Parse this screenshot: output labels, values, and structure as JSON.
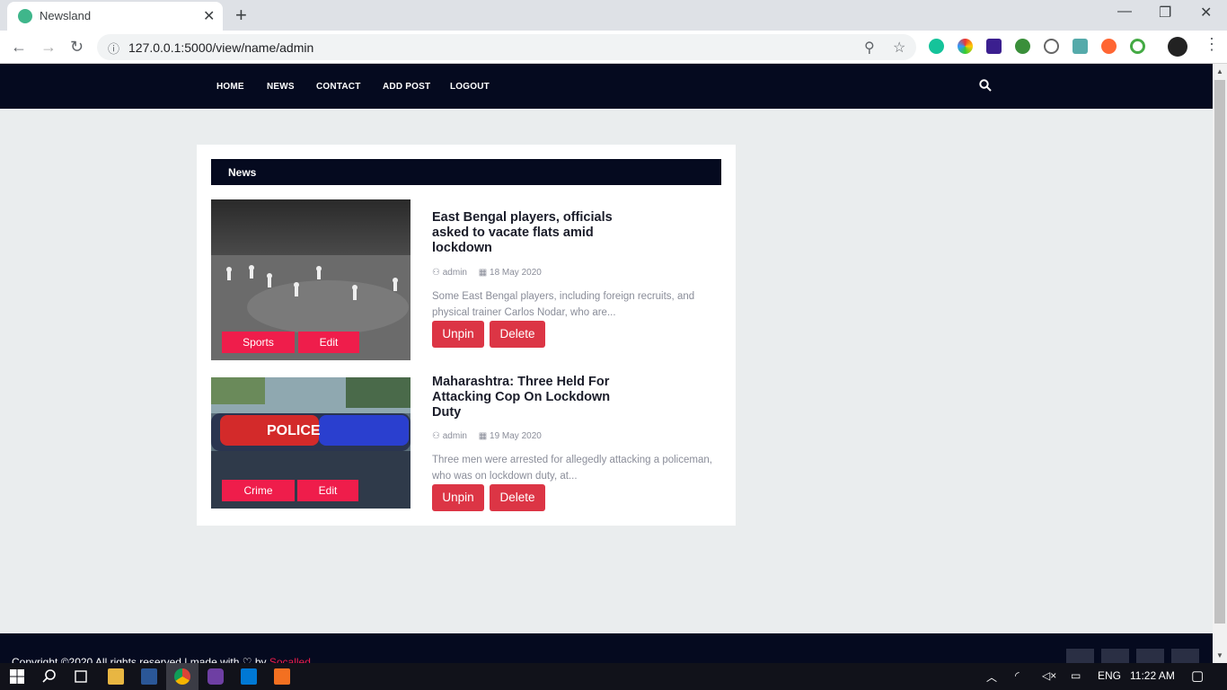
{
  "browser": {
    "tab_title": "Newsland",
    "tab_close": "✕",
    "new_tab": "+",
    "url": "127.0.0.1:5000/view/name/admin",
    "back": "←",
    "forward": "→",
    "reload": "↻",
    "info": "ⓘ",
    "zoom": "⚲",
    "star": "☆",
    "min": "—",
    "max": "❐",
    "close": "✕"
  },
  "nav": {
    "items": [
      "HOME",
      "NEWS",
      "CONTACT",
      "ADD POST",
      "LOGOUT"
    ]
  },
  "section": {
    "title": "News"
  },
  "posts": [
    {
      "title": "East Bengal players, officials asked to vacate flats amid lockdown",
      "author": "admin",
      "date": "18 May 2020",
      "excerpt": "Some East Bengal players, including foreign recruits, and physical trainer Carlos Nodar, who are...",
      "category": "Sports",
      "edit": "Edit",
      "unpin": "Unpin",
      "delete": "Delete"
    },
    {
      "title": "Maharashtra: Three Held For Attacking Cop On Lockdown Duty",
      "author": "admin",
      "date": "19 May 2020",
      "excerpt": "Three men were arrested for allegedly attacking a policeman, who was on lockdown duty, at...",
      "category": "Crime",
      "edit": "Edit",
      "unpin": "Unpin",
      "delete": "Delete"
    }
  ],
  "footer": {
    "text": "Copyright ©2020 All rights reserved | made with ♡ by",
    "brand": "Socalled"
  },
  "taskbar": {
    "lang": "ENG",
    "time": "11:22 AM"
  },
  "colors": {
    "nav_bg": "#050a1f",
    "accent": "#ef1d4b",
    "button": "#dc3545",
    "page_bg": "#eaedee"
  }
}
